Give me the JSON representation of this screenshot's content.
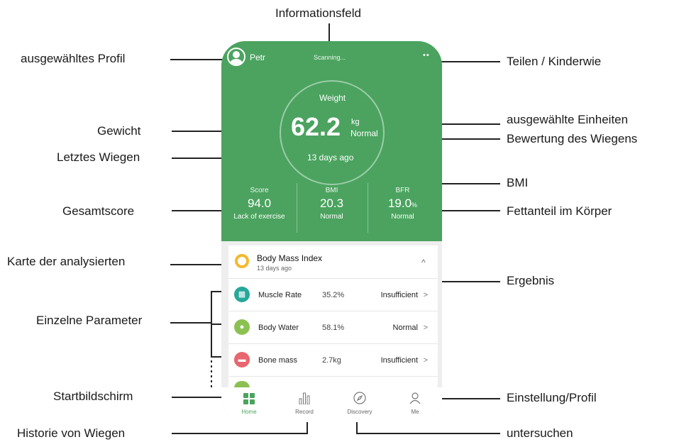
{
  "annotations": {
    "info_field": "Informationsfeld",
    "selected_profile": "ausgewähltes Profil",
    "share": "Teilen / Kinderwie",
    "weight": "Gewicht",
    "units": "ausgewählte Einheiten",
    "rating": "Bewertung des Wiegens",
    "last_weigh": "Letztes Wiegen",
    "bmi": "BMI",
    "total_score": "Gesamtscore",
    "body_fat": "Fettanteil im Körper",
    "card_map": "Karte der analysierten",
    "result": "Ergebnis",
    "params": "Einzelne Parameter",
    "home_screen": "Startbildschirm",
    "settings": "Einstellung/Profil",
    "history": "Historie von Wiegen",
    "explore": "untersuchen"
  },
  "app": {
    "profile_name": "Petr",
    "status": "Scanning...",
    "more": "••",
    "weight_label": "Weight",
    "weight_value": "62.2",
    "weight_unit": "kg",
    "weight_status": "Normal",
    "last_measured": "13 days ago",
    "stats": [
      {
        "label": "Score",
        "value": "94.0",
        "unit": "",
        "status": "Lack of exercise"
      },
      {
        "label": "BMI",
        "value": "20.3",
        "unit": "",
        "status": "Normal"
      },
      {
        "label": "BFR",
        "value": "19.0",
        "unit": "%",
        "status": "Normal"
      }
    ],
    "card": {
      "title": "Body Mass Index",
      "subtitle": "13 days ago",
      "collapse": "^"
    },
    "rows": [
      {
        "name": "Muscle Rate",
        "value": "35.2%",
        "result": "Insufficient",
        "arrow": ">",
        "color": "#26a89a"
      },
      {
        "name": "Body Water",
        "value": "58.1%",
        "result": "Normal",
        "arrow": ">",
        "color": "#8cc152"
      },
      {
        "name": "Bone mass",
        "value": "2.7kg",
        "result": "Insufficient",
        "arrow": ">",
        "color": "#e8666e"
      }
    ],
    "tabs": [
      {
        "label": "Home"
      },
      {
        "label": "Record"
      },
      {
        "label": "Discovery"
      },
      {
        "label": "Me"
      }
    ],
    "accent": "#4ba35f"
  }
}
